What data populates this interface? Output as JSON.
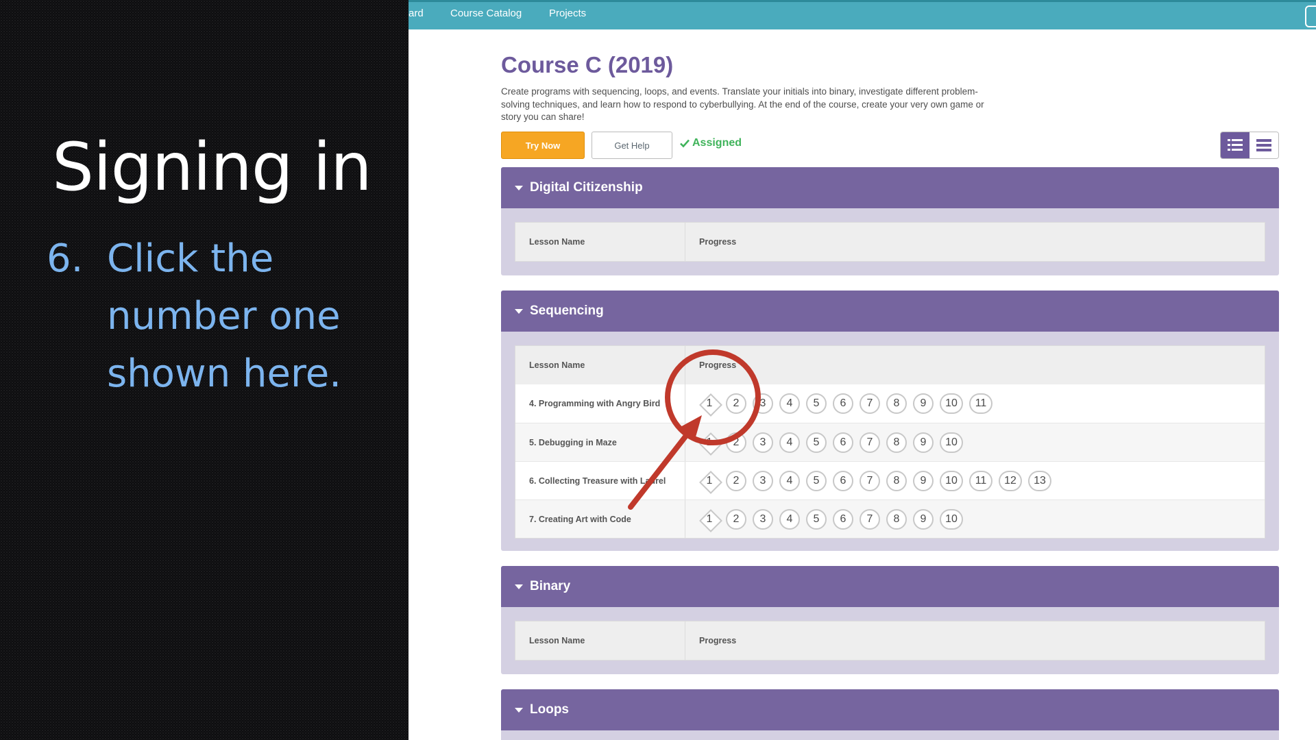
{
  "slide": {
    "title": "Signing in",
    "step_number": "6.",
    "step_lines": [
      "Click the",
      "number one",
      "shown here."
    ]
  },
  "nav": {
    "items": [
      "ard",
      "Course Catalog",
      "Projects"
    ]
  },
  "course": {
    "title": "Course C (2019)",
    "description": "Create programs with sequencing, loops, and events. Translate your initials into binary, investigate different problem-solving techniques, and learn how to respond to cyberbullying. At the end of the course, create your very own game or story you can share!",
    "try_label": "Try Now",
    "help_label": "Get Help",
    "assigned_label": "Assigned"
  },
  "table_headers": {
    "lesson": "Lesson Name",
    "progress": "Progress"
  },
  "sections": [
    {
      "title": "Digital Citizenship",
      "lessons": []
    },
    {
      "title": "Sequencing",
      "lessons": [
        {
          "name": "4. Programming with Angry Bird",
          "levels": [
            "1",
            "2",
            "3",
            "4",
            "5",
            "6",
            "7",
            "8",
            "9",
            "10",
            "11"
          ]
        },
        {
          "name": "5. Debugging in Maze",
          "levels": [
            "1",
            "2",
            "3",
            "4",
            "5",
            "6",
            "7",
            "8",
            "9",
            "10"
          ]
        },
        {
          "name": "6. Collecting Treasure with Laurel",
          "levels": [
            "1",
            "2",
            "3",
            "4",
            "5",
            "6",
            "7",
            "8",
            "9",
            "10",
            "11",
            "12",
            "13"
          ]
        },
        {
          "name": "7. Creating Art with Code",
          "levels": [
            "1",
            "2",
            "3",
            "4",
            "5",
            "6",
            "7",
            "8",
            "9",
            "10"
          ]
        }
      ]
    },
    {
      "title": "Binary",
      "lessons": []
    },
    {
      "title": "Loops",
      "lessons": []
    }
  ],
  "colors": {
    "nav": "#4aabbd",
    "section_header": "#76659f",
    "title": "#6d5a9c",
    "try_button": "#f6a623",
    "assigned": "#3fb35a",
    "annotation": "#c0392b",
    "step_text": "#7cb4ee"
  }
}
